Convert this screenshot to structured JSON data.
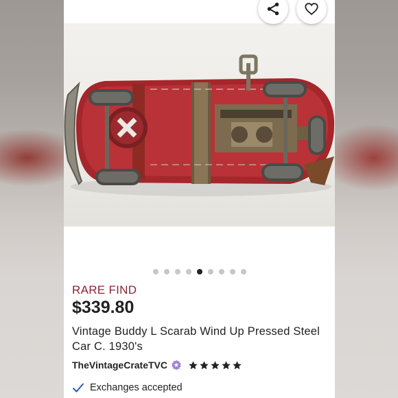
{
  "listing": {
    "badge": "RARE FIND",
    "price": "$339.80",
    "title": "Vintage Buddy L Scarab Wind Up Pressed Steel Car C. 1930's",
    "seller": "TheVintageCrateTVC",
    "rating_stars": 5,
    "feature": "Exchanges accepted"
  },
  "gallery": {
    "total_images": 9,
    "active_index": 5
  },
  "icons": {
    "share": "share-icon",
    "favorite": "heart-icon",
    "star_seller": "star-seller-badge-icon",
    "rating": "star-icon",
    "check": "check-icon"
  },
  "colors": {
    "badge": "#8c2431",
    "star_seller": "#a381d6",
    "text": "#222222"
  }
}
